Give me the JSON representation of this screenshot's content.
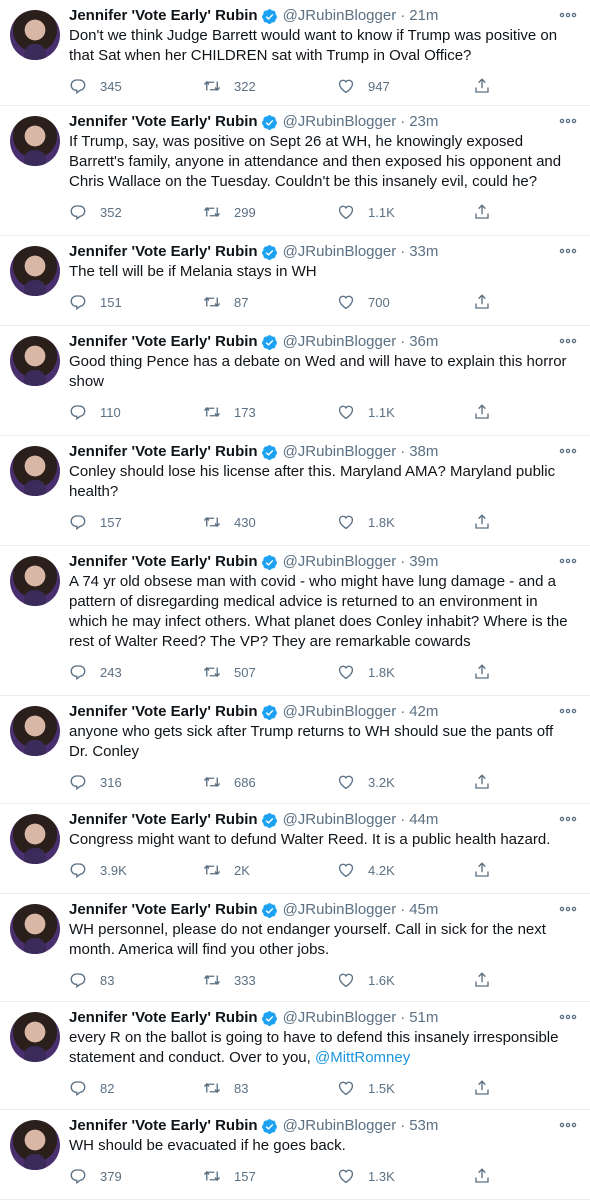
{
  "tweets": [
    {
      "name": "Jennifer 'Vote Early' Rubin",
      "handle": "@JRubinBlogger",
      "time": "21m",
      "text": "Don't we think Judge Barrett would want to know if Trump was positive on that Sat when her CHILDREN sat with Trump in Oval Office?",
      "mention": "",
      "replies": "345",
      "retweets": "322",
      "likes": "947"
    },
    {
      "name": "Jennifer 'Vote Early' Rubin",
      "handle": "@JRubinBlogger",
      "time": "23m",
      "text": "If Trump, say, was positive on Sept 26 at WH, he knowingly exposed Barrett's family, anyone in attendance and then exposed his opponent and Chris Wallace on the Tuesday. Couldn't be this insanely evil, could he?",
      "mention": "",
      "replies": "352",
      "retweets": "299",
      "likes": "1.1K"
    },
    {
      "name": "Jennifer 'Vote Early' Rubin",
      "handle": "@JRubinBlogger",
      "time": "33m",
      "text": "The tell will be if Melania stays in WH",
      "mention": "",
      "replies": "151",
      "retweets": "87",
      "likes": "700"
    },
    {
      "name": "Jennifer 'Vote Early' Rubin",
      "handle": "@JRubinBlogger",
      "time": "36m",
      "text": "Good thing Pence has a debate on Wed and will have to explain this horror show",
      "mention": "",
      "replies": "110",
      "retweets": "173",
      "likes": "1.1K"
    },
    {
      "name": "Jennifer 'Vote Early' Rubin",
      "handle": "@JRubinBlogger",
      "time": "38m",
      "text": "Conley should lose his license after this. Maryland AMA? Maryland public health?",
      "mention": "",
      "replies": "157",
      "retweets": "430",
      "likes": "1.8K"
    },
    {
      "name": "Jennifer 'Vote Early' Rubin",
      "handle": "@JRubinBlogger",
      "time": "39m",
      "text": "A 74 yr old obsese man with covid - who might have lung damage - and a pattern of disregarding medical advice is returned to an environment in which he may infect others. What planet does Conley inhabit? Where is the rest of Walter Reed? The VP? They are remarkable cowards",
      "mention": "",
      "replies": "243",
      "retweets": "507",
      "likes": "1.8K"
    },
    {
      "name": "Jennifer 'Vote Early' Rubin",
      "handle": "@JRubinBlogger",
      "time": "42m",
      "text": "anyone who gets sick after Trump returns to WH should sue the pants off Dr. Conley",
      "mention": "",
      "replies": "316",
      "retweets": "686",
      "likes": "3.2K"
    },
    {
      "name": "Jennifer 'Vote Early' Rubin",
      "handle": "@JRubinBlogger",
      "time": "44m",
      "text": "Congress might want to defund Walter Reed. It is a public health hazard.",
      "mention": "",
      "replies": "3.9K",
      "retweets": "2K",
      "likes": "4.2K"
    },
    {
      "name": "Jennifer 'Vote Early' Rubin",
      "handle": "@JRubinBlogger",
      "time": "45m",
      "text": "WH personnel, please do not endanger yourself. Call in sick for the next month. America will find you other jobs.",
      "mention": "",
      "replies": "83",
      "retweets": "333",
      "likes": "1.6K"
    },
    {
      "name": "Jennifer 'Vote Early' Rubin",
      "handle": "@JRubinBlogger",
      "time": "51m",
      "text": "every R on the ballot is going to have to defend this insanely irresponsible statement and conduct. Over to you, ",
      "mention": "@MittRomney",
      "replies": "82",
      "retweets": "83",
      "likes": "1.5K"
    },
    {
      "name": "Jennifer 'Vote Early' Rubin",
      "handle": "@JRubinBlogger",
      "time": "53m",
      "text": "WH should be evacuated if he goes back.",
      "mention": "",
      "replies": "379",
      "retweets": "157",
      "likes": "1.3K"
    }
  ],
  "separator": "·",
  "colors": {
    "text": "#0f1419",
    "secondary": "#5b7083",
    "verified": "#1da1f2",
    "link": "#1b95e0",
    "divider": "#e6ecf0"
  }
}
